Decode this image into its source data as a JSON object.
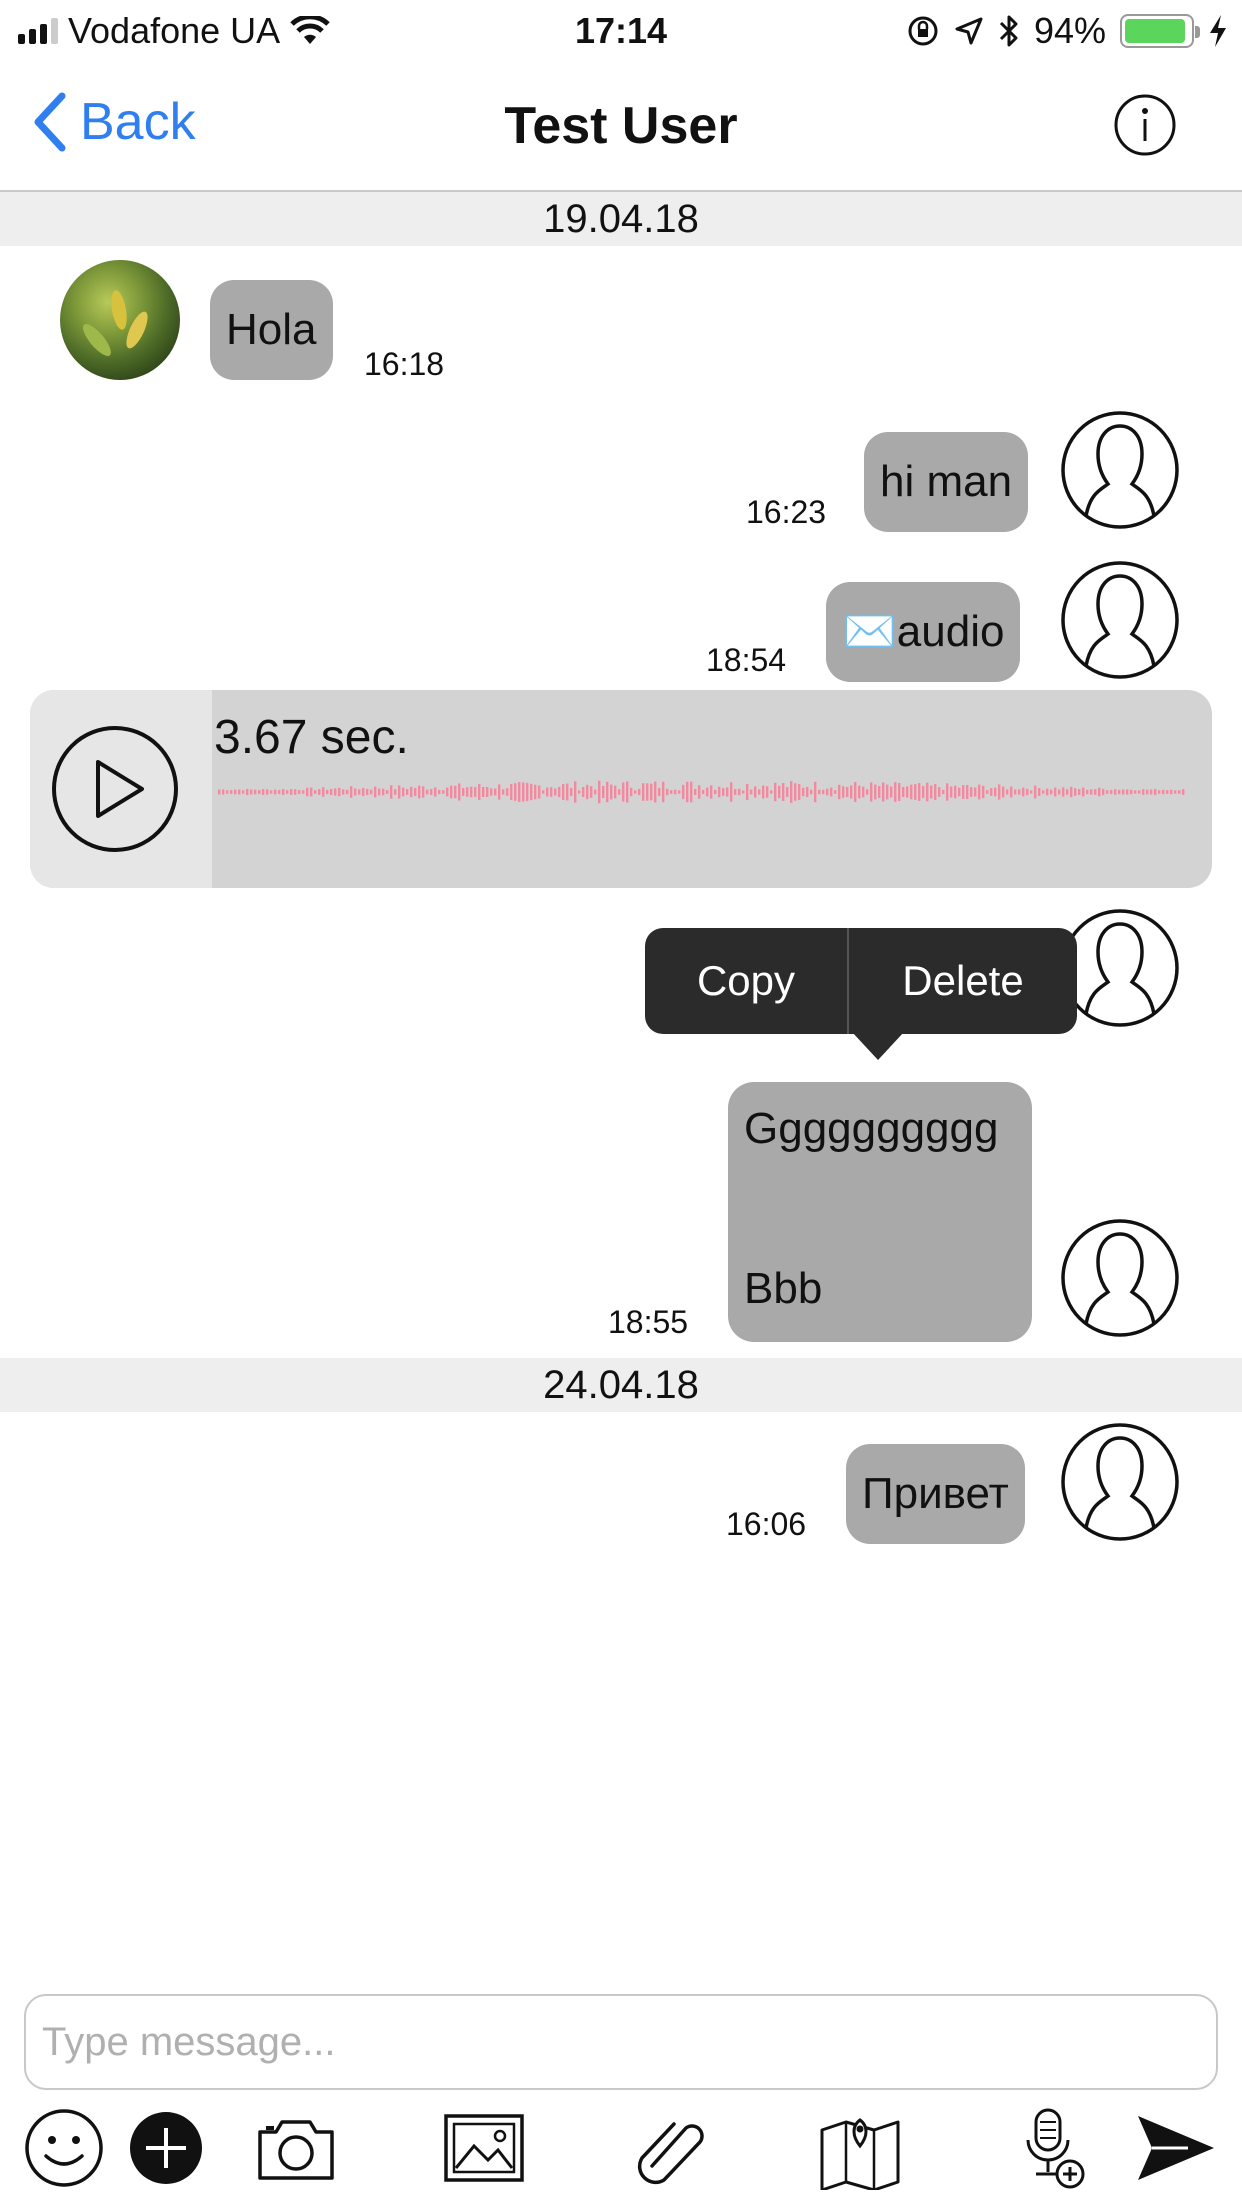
{
  "status_bar": {
    "carrier": "Vodafone UA",
    "time": "17:14",
    "battery_percent": "94%",
    "battery_level": 0.94,
    "icons": [
      "signal-icon",
      "wifi-icon",
      "orientation-lock-icon",
      "location-icon",
      "bluetooth-icon",
      "battery-icon",
      "charging-icon"
    ]
  },
  "nav": {
    "back_label": "Back",
    "title": "Test User",
    "accent_color": "#2f7ff0"
  },
  "chat": {
    "dates": [
      "19.04.18",
      "24.04.18"
    ],
    "messages": [
      {
        "text": "Hola",
        "time": "16:18",
        "side": "incoming"
      },
      {
        "text": "hi man",
        "time": "16:23",
        "side": "outgoing"
      },
      {
        "text": "✉️audio",
        "time": "18:54",
        "side": "outgoing"
      },
      {
        "lines": [
          "Gggggggggg",
          "Bbb"
        ],
        "time": "18:55",
        "side": "outgoing"
      },
      {
        "text": "Привет",
        "time": "16:06",
        "side": "outgoing"
      }
    ],
    "audio": {
      "duration": "3.67 sec.",
      "waveform_color": "#f08aa0"
    }
  },
  "context_menu": {
    "copy": "Copy",
    "delete": "Delete"
  },
  "composer": {
    "placeholder": "Type message...",
    "value": ""
  },
  "toolbar": {
    "icons": [
      "emoji-icon",
      "add-icon",
      "camera-icon",
      "image-icon",
      "attachment-icon",
      "map-icon",
      "microphone-add-icon",
      "send-icon"
    ]
  },
  "colors": {
    "bubble": "#a9a9a9",
    "date_separator": "#eeeeee",
    "audio_card": "#d3d3d3",
    "context_menu": "#2b2b2b"
  }
}
